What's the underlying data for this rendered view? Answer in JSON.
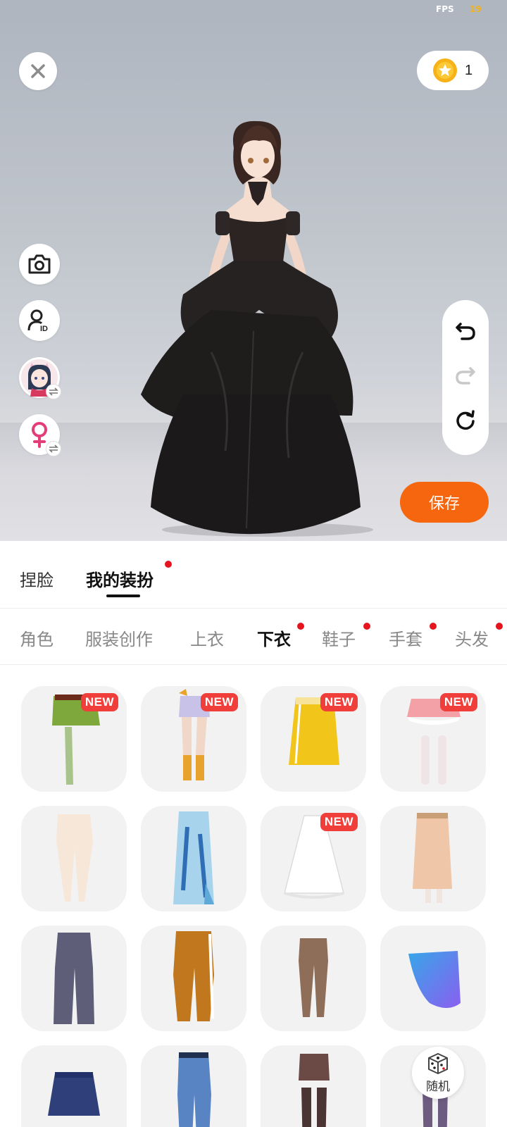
{
  "status": {
    "fps_label": "FPS",
    "fps_value": "19"
  },
  "coins": {
    "count": "1"
  },
  "actions": {
    "save_label": "保存",
    "random_label": "随机"
  },
  "main_tabs": [
    {
      "label": "捏脸",
      "active": false
    },
    {
      "label": "我的装扮",
      "active": true,
      "dot": true
    }
  ],
  "sub_tabs": [
    {
      "label": "角色"
    },
    {
      "label": "服装创作"
    },
    {
      "label": "上衣"
    },
    {
      "label": "下衣",
      "active": true,
      "dot": true
    },
    {
      "label": "鞋子",
      "dot": true
    },
    {
      "label": "手套",
      "dot": true
    },
    {
      "label": "头发",
      "dot": true
    }
  ],
  "items": [
    {
      "name": "green-skirt-leggings",
      "badge": "NEW"
    },
    {
      "name": "lavender-shorts-boots",
      "badge": "NEW"
    },
    {
      "name": "yellow-skirt",
      "badge": "NEW"
    },
    {
      "name": "pink-ruffle-skirt-socks",
      "badge": "NEW"
    },
    {
      "name": "cream-tights"
    },
    {
      "name": "blue-printed-skirt"
    },
    {
      "name": "white-lace-skirt",
      "badge": "NEW"
    },
    {
      "name": "beige-long-skirt"
    },
    {
      "name": "grey-flared-jeans"
    },
    {
      "name": "orange-track-pants"
    },
    {
      "name": "brown-leggings"
    },
    {
      "name": "blue-sarong"
    },
    {
      "name": "navy-pleated-skirt"
    },
    {
      "name": "blue-jeans"
    },
    {
      "name": "brown-shorts-stockings"
    },
    {
      "name": "purple-tights"
    }
  ],
  "colors": {
    "accent": "#f5660f",
    "badge": "#f03f3b",
    "dot": "#e5141f"
  }
}
